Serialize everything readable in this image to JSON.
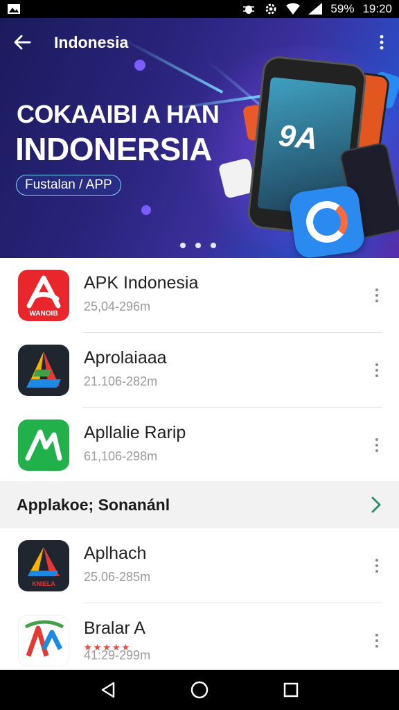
{
  "status_bar": {
    "battery": "59%",
    "time": "19:20"
  },
  "header": {
    "title": "Indonesia"
  },
  "hero": {
    "title_line1": "COKAAIBI A HAN",
    "title_line2": "INDONERSIA",
    "pill_label": "Fustalan / APP",
    "phone_text": "9A",
    "carousel_dots": 3
  },
  "apps": [
    {
      "name": "APK Indonesia",
      "meta": "25,04-296m",
      "icon_text": "WANOIB",
      "icon_color": "#e8262b"
    },
    {
      "name": "Aprolaiaaa",
      "meta": "21.106-282m",
      "icon_color": "#1f2630"
    },
    {
      "name": "Apllalie Rarip",
      "meta": "61,106-298m",
      "icon_color": "#22b04b"
    }
  ],
  "section": {
    "title": "Applakoe; Sonanánl"
  },
  "apps2": [
    {
      "name": "Aplhach",
      "meta": "25.06-285m",
      "icon_text": "KNIELA",
      "icon_color": "#1f2630"
    },
    {
      "name": "Bralar A",
      "meta": "41:29-299m",
      "rating_stars": 5,
      "icon_color": "#ffffff"
    }
  ],
  "colors": {
    "accent_arrow": "#2f8f6a",
    "hero_gradient_start": "#1b1b5c",
    "hero_gradient_end": "#5a2aa8"
  }
}
